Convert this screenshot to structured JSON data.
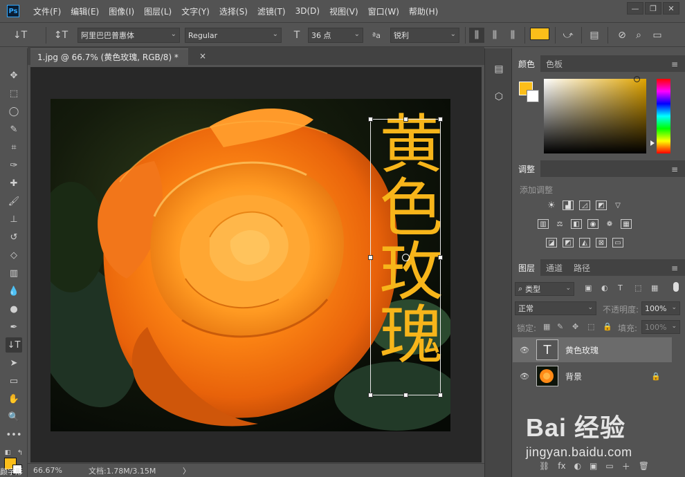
{
  "app": {
    "logo": "Ps",
    "menu": [
      "文件(F)",
      "编辑(E)",
      "图像(I)",
      "图层(L)",
      "文字(Y)",
      "选择(S)",
      "滤镜(T)",
      "3D(D)",
      "视图(V)",
      "窗口(W)",
      "帮助(H)"
    ],
    "window_controls": [
      "—",
      "❐",
      "✕"
    ]
  },
  "options_bar": {
    "font_family": "阿里巴巴普惠体",
    "font_style": "Regular",
    "font_size": "36 点",
    "aa_icon": "ªa",
    "antialias": "锐利",
    "text_color": "#fbbe1a"
  },
  "document": {
    "tab_title": "1.jpg @ 66.7% (黄色玫瑰, RGB/8) *",
    "close": "×",
    "type_text": "黄色玫瑰"
  },
  "status": {
    "zoom": "66.67%",
    "doc_info": "文档:1.78M/3.15M",
    "arrow": "〉",
    "clipped_left": "颜字形"
  },
  "color_panel": {
    "tabs": [
      "颜色",
      "色板"
    ],
    "fg": "#fbbe1a",
    "bg": "#ffffff"
  },
  "adjustments_panel": {
    "tab": "调整",
    "hint": "添加调整"
  },
  "layers_panel": {
    "tabs": [
      "图层",
      "通道",
      "路径"
    ],
    "filter_label": "类型",
    "blend_mode": "正常",
    "opacity_label": "不透明度:",
    "opacity": "100%",
    "lock_label": "锁定:",
    "fill_label": "填充:",
    "fill": "100%",
    "layers": [
      {
        "name": "黄色玫瑰",
        "type": "text",
        "thumb": "T",
        "selected": true
      },
      {
        "name": "背景",
        "type": "image",
        "locked": true,
        "selected": false
      }
    ],
    "bottom_icons": [
      "⛓",
      "fx",
      "◐",
      "▣",
      "▭",
      "＋",
      "🗑"
    ]
  },
  "watermark": {
    "logo": "Bai 经验",
    "url": "jingyan.baidu.com"
  },
  "icons": {
    "tools": [
      "move-icon",
      "marquee-icon",
      "lasso-icon",
      "quick-select-icon",
      "crop-icon",
      "eyedropper-icon",
      "healing-icon",
      "brush-icon",
      "stamp-icon",
      "history-brush-icon",
      "eraser-icon",
      "gradient-icon",
      "blur-icon",
      "dodge-icon",
      "pen-icon",
      "type-icon",
      "path-select-icon",
      "rectangle-icon",
      "hand-icon",
      "zoom-icon",
      "more-tools-icon"
    ]
  }
}
